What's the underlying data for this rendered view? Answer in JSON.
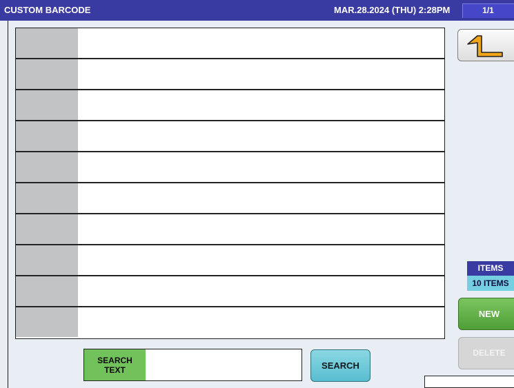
{
  "header": {
    "title": "CUSTOM BARCODE",
    "datetime": "MAR.28.2024 (THU)  2:28PM",
    "page_indicator": "1/1"
  },
  "list": {
    "rows": [
      {
        "key": "",
        "value": ""
      },
      {
        "key": "",
        "value": ""
      },
      {
        "key": "",
        "value": ""
      },
      {
        "key": "",
        "value": ""
      },
      {
        "key": "",
        "value": ""
      },
      {
        "key": "",
        "value": ""
      },
      {
        "key": "",
        "value": ""
      },
      {
        "key": "",
        "value": ""
      },
      {
        "key": "",
        "value": ""
      },
      {
        "key": "",
        "value": ""
      }
    ]
  },
  "sidepanel": {
    "back_icon": "return-arrow-icon",
    "items_label": "ITEMS",
    "items_count": "10 ITEMS",
    "new_label": "NEW",
    "delete_label": "DELETE"
  },
  "search": {
    "label": "SEARCH\nTEXT",
    "value": "",
    "placeholder": "",
    "button_label": "SEARCH"
  },
  "colors": {
    "title_bar": "#3a3aa3",
    "new_button": "#5fae45",
    "search_button": "#6fcddd",
    "search_label_bg": "#72c25c",
    "items_count_bg": "#74cfe0"
  }
}
